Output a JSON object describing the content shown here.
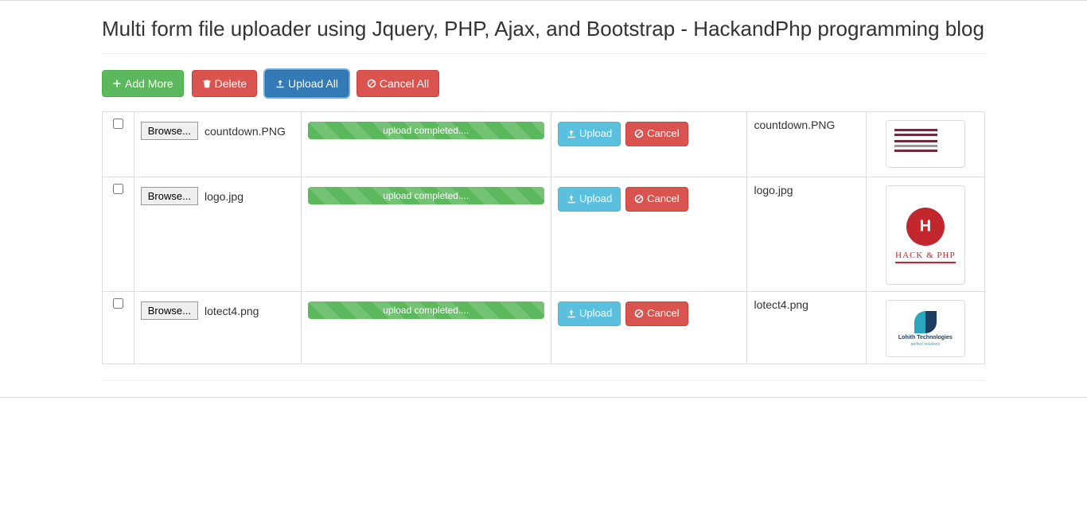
{
  "page": {
    "title": "Multi form file uploader using Jquery, PHP, Ajax, and Bootstrap - HackandPhp programming blog"
  },
  "toolbar": {
    "add_more": "Add More",
    "delete": "Delete",
    "upload_all": "Upload All",
    "cancel_all": "Cancel All"
  },
  "row_actions": {
    "browse": "Browse...",
    "upload": "Upload",
    "cancel": "Cancel"
  },
  "progress": {
    "completed_text": "upload completed....",
    "percent": 100
  },
  "files": [
    {
      "selected_name": "countdown.PNG",
      "result_name": "countdown.PNG"
    },
    {
      "selected_name": "logo.jpg",
      "result_name": "logo.jpg"
    },
    {
      "selected_name": "lotect4.png",
      "result_name": "lotect4.png"
    }
  ],
  "thumbs": {
    "brand_text": "HACK & PHP",
    "lt_text": "Lohith Technologies",
    "lt_sub": "perfect solutions"
  }
}
